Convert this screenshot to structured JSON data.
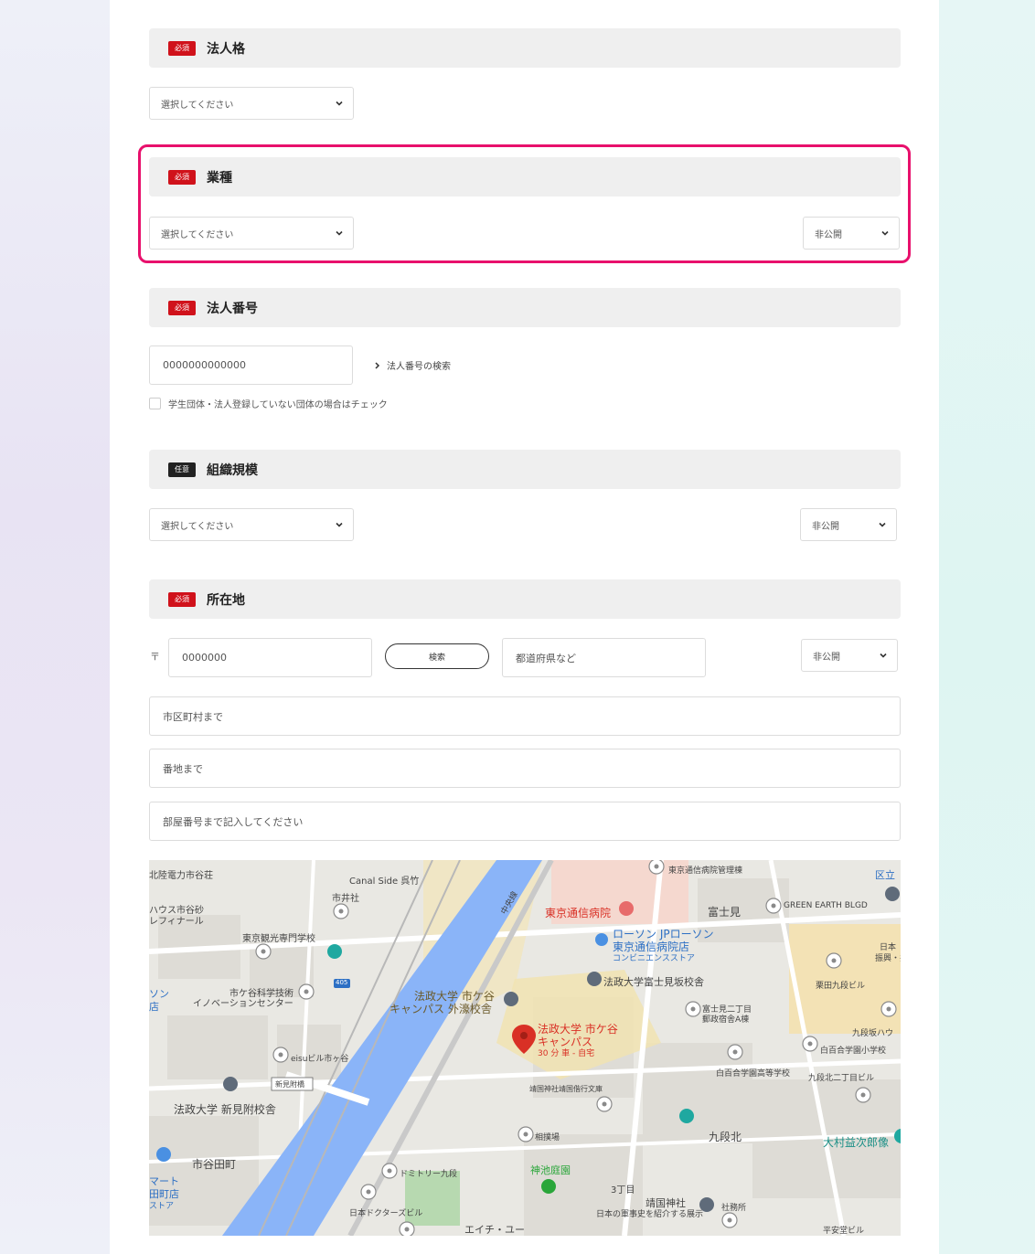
{
  "sections": {
    "legal_entity": {
      "badge": "必須",
      "title": "法人格",
      "select": "選択してください"
    },
    "industry": {
      "badge": "必須",
      "title": "業種",
      "select": "選択してください",
      "visibility": "非公開"
    },
    "corporate_number": {
      "badge": "必須",
      "title": "法人番号",
      "input": "0000000000000",
      "search_link": "法人番号の検索",
      "checkbox_label": "学生団体・法人登録していない団体の場合はチェック"
    },
    "org_size": {
      "badge": "任意",
      "title": "組織規模",
      "select": "選択してください",
      "visibility": "非公開"
    },
    "location": {
      "badge": "必須",
      "title": "所在地",
      "postal_mark": "〒",
      "postal": "0000000",
      "search_button": "検索",
      "prefecture_placeholder": "都道府県など",
      "visibility": "非公開",
      "city_placeholder": "市区町村まで",
      "street_placeholder": "番地まで",
      "room_placeholder": "部屋番号まで記入してください"
    }
  },
  "map": {
    "labels": {
      "l1": "北陸電力市谷荘",
      "l2": "Canal Side 呉竹",
      "l3": "市井社",
      "l4": "ハウス市谷砂",
      "l5": "レフィナール",
      "l6": "東京観光専門学校",
      "l7": "市ケ谷科学技術",
      "l8": "イノベーションセンター",
      "l9": "法政大学 市ケ谷",
      "l10": "キャンパス 外濠校舎",
      "l11": "東京通信病院",
      "l12": "ローソン JPローソン",
      "l13": "東京通信病院店",
      "l14": "コンビニエンスストア",
      "l15": "富士見",
      "l16": "GREEN EARTH BLGD",
      "l17": "法政大学富士見坂校舎",
      "l18": "栗田九段ビル",
      "l19": "富士見二丁目",
      "l20": "郵政宿舎A棟",
      "l21": "法政大学 市ケ谷",
      "l22": "キャンパス",
      "l23": "30 分 車 - 自宅",
      "l24": "九段坂ハウ",
      "l25": "白百合学園小学校",
      "l26": "eisuビル市ヶ谷",
      "l27": "白百合学園高等学校",
      "l28": "九段北二丁目ビル",
      "l29": "新見附橋",
      "l30": "靖国神社靖国偕行文庫",
      "l31": "法政大学 新見附校舎",
      "l32": "相撲場",
      "l33": "九段北",
      "l34": "大村益次郎像",
      "l35": "市谷田町",
      "l36": "ドミトリー九段",
      "l37": "神池庭園",
      "l38": "3丁目",
      "l39": "靖国神社",
      "l40": "日本の軍事史を紹介する展示",
      "l41": "社務所",
      "l42": "日本ドクターズビル",
      "l43": "エイチ・ユー",
      "l44": "東京通信病院管理棟",
      "l45": "区立",
      "l46": "日本",
      "l47": "振興・共",
      "l48": "405",
      "l49": "中央線",
      "l50": "マート",
      "l51": "田町店",
      "l52": "ストア",
      "l53": "平安堂ビル",
      "l54": "ソン",
      "l55": "店"
    },
    "colors": {
      "water": "#8ab4f8",
      "highlight": "#e8106c",
      "required": "#d0121b",
      "poi_red": "#d93025"
    }
  }
}
